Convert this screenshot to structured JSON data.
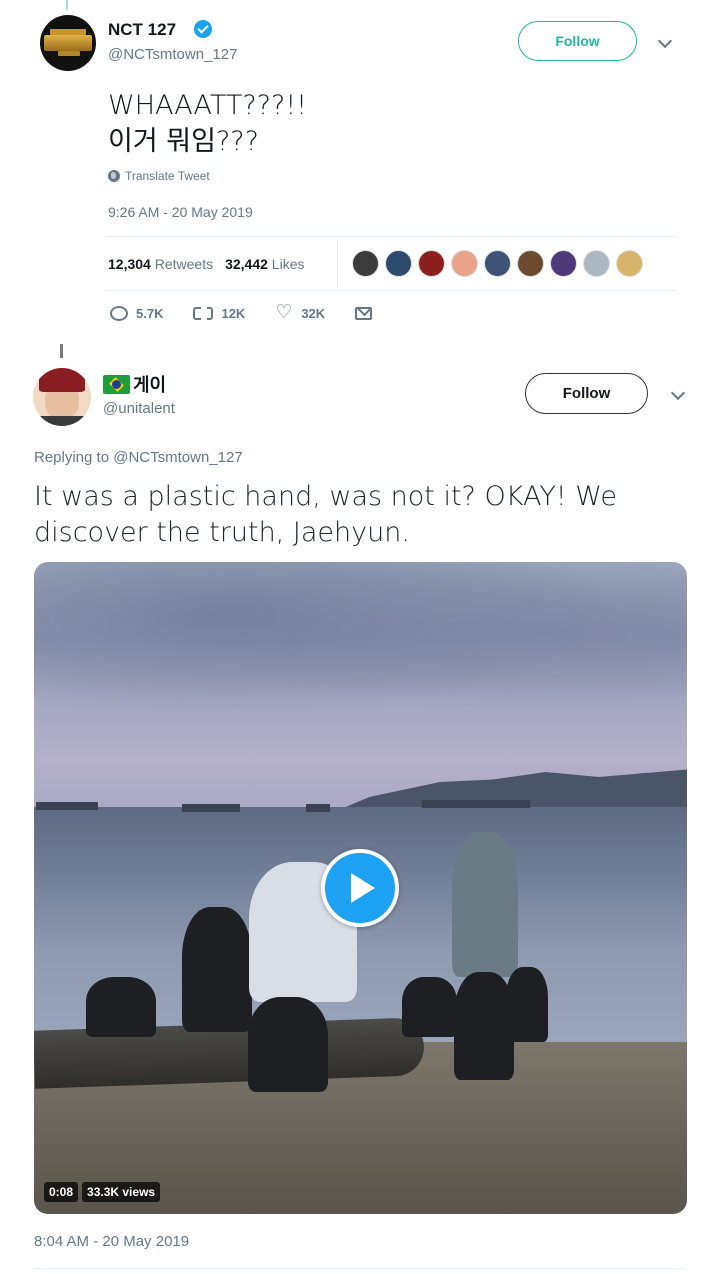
{
  "tweet1": {
    "name": "NCT 127",
    "handle": "@NCTsmtown_127",
    "follow_label": "Follow",
    "text_line1": "WHAAATT???!!",
    "text_line2": "이거 뭐임???",
    "translate_label": "Translate Tweet",
    "timestamp": "9:26 AM - 20 May 2019",
    "retweets_count": "12,304",
    "retweets_label": "Retweets",
    "likes_count": "32,442",
    "likes_label": "Likes",
    "liker_avatar_colors": [
      "#3b3b3b",
      "#2c4a6b",
      "#8c1f1f",
      "#e8a38a",
      "#3d5274",
      "#6b4a2f",
      "#4e3a7a",
      "#aab8c2",
      "#d6b56a"
    ],
    "actions": {
      "reply_count": "5.7K",
      "retweet_count": "12K",
      "like_count": "32K"
    }
  },
  "tweet2": {
    "name": "게이",
    "handle": "@unitalent",
    "follow_label": "Follow",
    "replying_to": "Replying to @NCTsmtown_127",
    "text": "It was a plastic hand, was not it? OKAY! We discover the truth, Jaehyun.",
    "video": {
      "duration": "0:08",
      "views": "33.3K views"
    },
    "timestamp": "8:04 AM - 20 May 2019"
  },
  "colors": {
    "accent": "#1da1f2",
    "follow_green": "#1fb89a",
    "muted": "#657786"
  }
}
